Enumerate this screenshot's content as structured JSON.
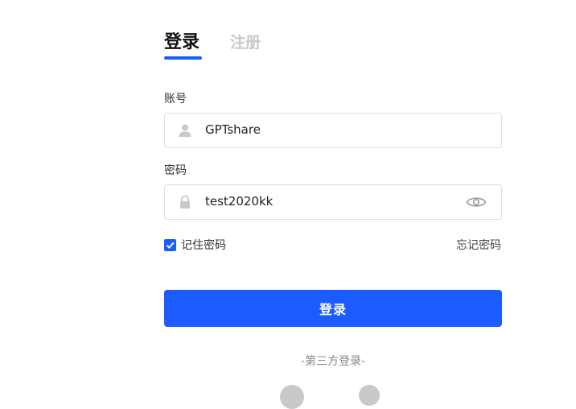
{
  "tabs": [
    {
      "label": "登录",
      "active": true
    },
    {
      "label": "注册",
      "active": false
    }
  ],
  "account": {
    "label": "账号",
    "value": "GPTshare",
    "icon": "user-icon"
  },
  "password": {
    "label": "密码",
    "value": "test2020kk",
    "icon": "lock-icon",
    "toggle_icon": "eye-icon"
  },
  "remember": {
    "label": "记住密码",
    "checked": true
  },
  "forgot_label": "忘记密码",
  "login_label": "登录",
  "third_party_label": "-第三方登录-",
  "social_icons": [
    "wechat-icon",
    "qq-icon"
  ],
  "colors": {
    "accent": "#1a5cff",
    "inactive_tab": "#c8c8c8",
    "icon_gray": "#c9c9c9"
  }
}
